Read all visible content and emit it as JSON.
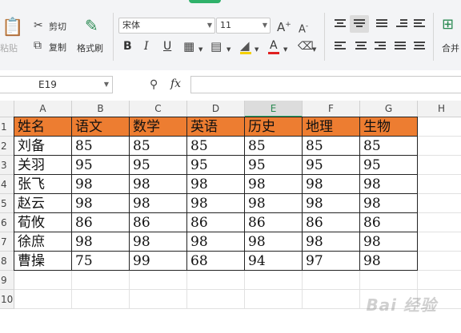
{
  "ribbon": {
    "paste_label": "粘贴",
    "cut_label": "剪切",
    "copy_label": "复制",
    "format_painter_label": "格式刷",
    "font_name": "宋体",
    "font_size": "11",
    "bold": "B",
    "italic": "I",
    "underline": "U",
    "merge_label": "合并"
  },
  "formula_bar": {
    "cell_ref": "E19",
    "fx_label": "fx",
    "value": ""
  },
  "columns": [
    "A",
    "B",
    "C",
    "D",
    "E",
    "F",
    "G",
    "H"
  ],
  "selected_column": "E",
  "rows": [
    "1",
    "2",
    "3",
    "4",
    "5",
    "6",
    "7",
    "8",
    "9",
    "10"
  ],
  "table": {
    "header": [
      "姓名",
      "语文",
      "数学",
      "英语",
      "历史",
      "地理",
      "生物"
    ],
    "body": [
      [
        "刘备",
        "85",
        "85",
        "85",
        "85",
        "85",
        "85"
      ],
      [
        "关羽",
        "95",
        "95",
        "95",
        "95",
        "95",
        "95"
      ],
      [
        "张飞",
        "98",
        "98",
        "98",
        "98",
        "98",
        "98"
      ],
      [
        "赵云",
        "98",
        "98",
        "98",
        "98",
        "98",
        "98"
      ],
      [
        "荀攸",
        "86",
        "86",
        "86",
        "86",
        "86",
        "86"
      ],
      [
        "徐庶",
        "98",
        "98",
        "98",
        "98",
        "98",
        "98"
      ],
      [
        "曹操",
        "75",
        "99",
        "68",
        "94",
        "97",
        "98"
      ]
    ]
  },
  "colors": {
    "header_fill": "#ed7d31",
    "accent": "#2fb16a"
  },
  "watermark": "Bai 经验"
}
